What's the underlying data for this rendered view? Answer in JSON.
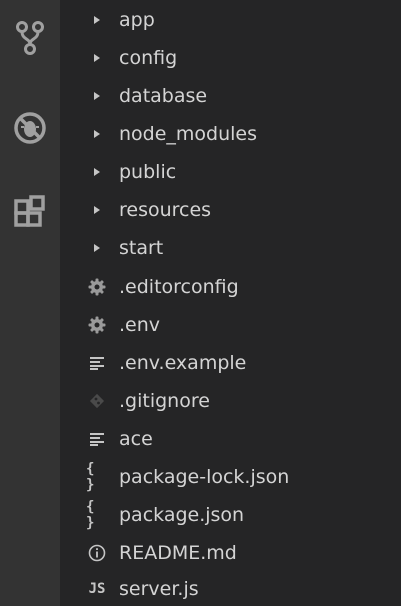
{
  "activity_bar": {
    "items": [
      {
        "icon": "source-control-icon"
      },
      {
        "icon": "debug-icon"
      },
      {
        "icon": "extensions-icon"
      }
    ]
  },
  "explorer": {
    "folders": [
      {
        "label": "app"
      },
      {
        "label": "config"
      },
      {
        "label": "database"
      },
      {
        "label": "node_modules"
      },
      {
        "label": "public"
      },
      {
        "label": "resources"
      },
      {
        "label": "start"
      }
    ],
    "files": [
      {
        "label": ".editorconfig",
        "icon": "gear-icon"
      },
      {
        "label": ".env",
        "icon": "gear-icon"
      },
      {
        "label": ".env.example",
        "icon": "lines-icon"
      },
      {
        "label": ".gitignore",
        "icon": "git-icon"
      },
      {
        "label": "ace",
        "icon": "lines-icon"
      },
      {
        "label": "package-lock.json",
        "icon": "json-icon",
        "glyph": "{ }"
      },
      {
        "label": "package.json",
        "icon": "json-icon",
        "glyph": "{ }"
      },
      {
        "label": "README.md",
        "icon": "info-icon"
      },
      {
        "label": "server.js",
        "icon": "js-icon",
        "glyph": "JS"
      }
    ]
  }
}
